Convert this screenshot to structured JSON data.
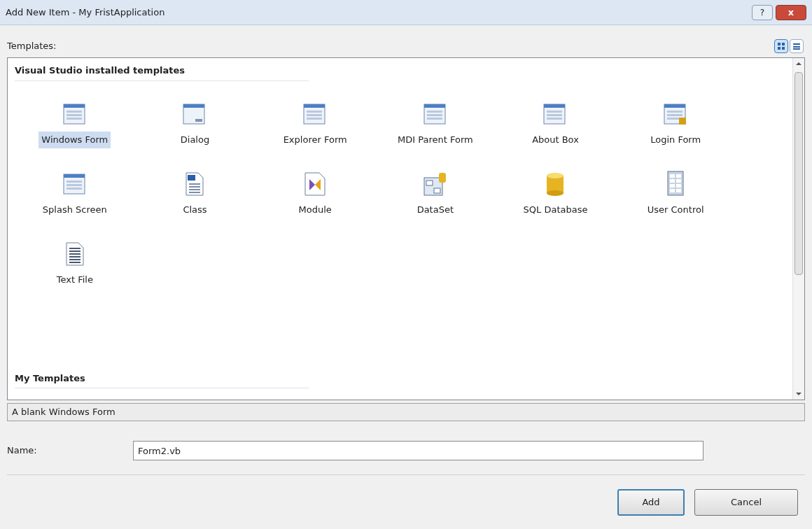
{
  "window": {
    "title": "Add New Item - My FristApplication",
    "help": "?",
    "close": "x"
  },
  "templates_label": "Templates:",
  "view_buttons": [
    {
      "selected": true
    },
    {
      "selected": false
    }
  ],
  "groups": [
    {
      "title": "Visual Studio installed templates",
      "items": [
        {
          "label": "Windows Form",
          "selected": true
        },
        {
          "label": "Dialog",
          "selected": false
        },
        {
          "label": "Explorer Form",
          "selected": false
        },
        {
          "label": "MDI Parent Form",
          "selected": false
        },
        {
          "label": "About Box",
          "selected": false
        },
        {
          "label": "Login Form",
          "selected": false
        },
        {
          "label": "Splash Screen",
          "selected": false
        },
        {
          "label": "Class",
          "selected": false
        },
        {
          "label": "Module",
          "selected": false
        },
        {
          "label": "DataSet",
          "selected": false
        },
        {
          "label": "SQL Database",
          "selected": false
        },
        {
          "label": "User Control",
          "selected": false
        },
        {
          "label": "Text File",
          "selected": false
        }
      ]
    },
    {
      "title": "My Templates"
    }
  ],
  "description": "A blank Windows Form",
  "name_field": {
    "label": "Name:",
    "value": "Form2.vb"
  },
  "buttons": [
    {
      "label": "Add",
      "kind": "default"
    },
    {
      "label": "Cancel",
      "kind": "normal"
    }
  ]
}
